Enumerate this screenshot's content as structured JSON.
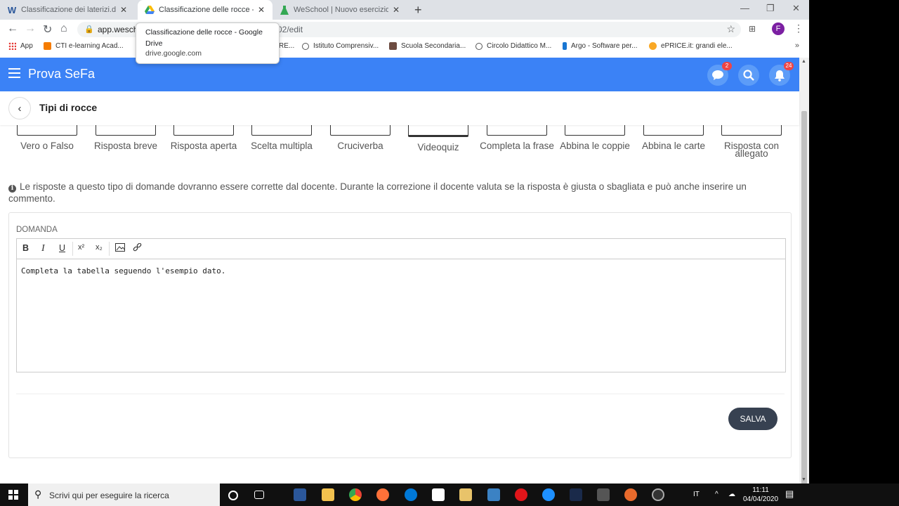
{
  "browser": {
    "tabs": [
      {
        "title": "Classificazione dei laterizi.docx -",
        "icon": "word-icon"
      },
      {
        "title": "Classificazione delle rocce - Goog",
        "icon": "drive-icon"
      },
      {
        "title": "WeSchool | Nuovo esercizio",
        "icon": "weschool-icon"
      }
    ],
    "url_host": "app.wesch",
    "url_path": "02/edit",
    "avatar_letter": "F",
    "bookmarks": [
      {
        "label": "App",
        "color": "#e53935"
      },
      {
        "label": "CTI e-learning Acad...",
        "color": "#f57c00"
      },
      {
        "label": "RE...",
        "color": "#8e0000"
      },
      {
        "label": "Istituto Comprensiv...",
        "color": "#555555"
      },
      {
        "label": "Scuola Secondaria...",
        "color": "#6d4c41"
      },
      {
        "label": "Circolo Didattico M...",
        "color": "#555555"
      },
      {
        "label": "Argo - Software per...",
        "color": "#1976d2"
      },
      {
        "label": "ePRICE.it: grandi ele...",
        "color": "#f9a825"
      }
    ],
    "tooltip": {
      "title": "Classificazione delle rocce - Google Drive",
      "domain": "drive.google.com"
    }
  },
  "app": {
    "brand": "Prova SeFa",
    "chat_badge": "2",
    "notif_badge": "24",
    "page_title": "Tipi di rocce",
    "accent": "#3b82f6"
  },
  "question_types": [
    {
      "label": "Vero o Falso"
    },
    {
      "label": "Risposta breve"
    },
    {
      "label": "Risposta aperta"
    },
    {
      "label": "Scelta multipla"
    },
    {
      "label": "Cruciverba"
    },
    {
      "label": "Videoquiz"
    },
    {
      "label": "Completa la frase"
    },
    {
      "label": "Abbina le coppie"
    },
    {
      "label": "Abbina le carte"
    },
    {
      "label": "Risposta con allegato"
    }
  ],
  "info_text": "Le risposte a questo tipo di domande dovranno essere corrette dal docente. Durante la correzione il docente valuta se la risposta è giusta o sbagliata e può anche inserire un commento.",
  "question": {
    "label": "DOMANDA",
    "toolbar": [
      "B",
      "I",
      "U",
      "x²",
      "x₂",
      "image-icon",
      "link-icon"
    ],
    "body": "Completa la tabella seguendo l'esempio dato."
  },
  "save_label": "SALVA",
  "taskbar": {
    "search_placeholder": "Scrivi qui per eseguire la ricerca",
    "lang": "IT",
    "time": "11:11",
    "date": "04/04/2020"
  }
}
